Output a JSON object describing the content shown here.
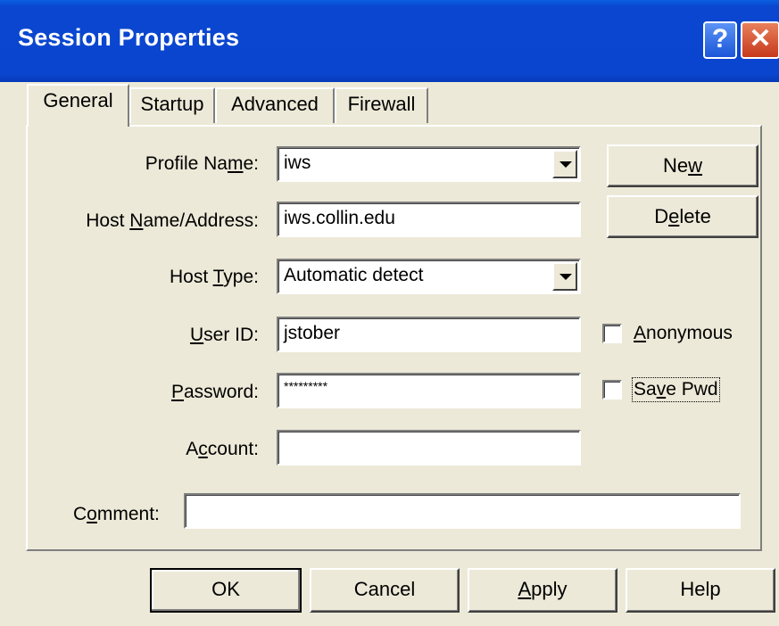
{
  "window": {
    "title": "Session Properties",
    "help_glyph": "?",
    "close_glyph": "✕"
  },
  "tabs": [
    {
      "label": "General"
    },
    {
      "label": "Startup"
    },
    {
      "label": "Advanced"
    },
    {
      "label": "Firewall"
    }
  ],
  "form": {
    "profile_name": {
      "label_pre": "Profile Na",
      "label_key": "m",
      "label_post": "e:",
      "value": "iws"
    },
    "host_name": {
      "label_pre": "Host ",
      "label_key": "N",
      "label_post": "ame/Address:",
      "value": "iws.collin.edu"
    },
    "host_type": {
      "label_pre": "Host ",
      "label_key": "T",
      "label_post": "ype:",
      "value": "Automatic detect"
    },
    "user_id": {
      "label_pre": "",
      "label_key": "U",
      "label_post": "ser ID:",
      "value": "jstober"
    },
    "password": {
      "label_pre": "",
      "label_key": "P",
      "label_post": "assword:",
      "value": "*********"
    },
    "account": {
      "label_pre": "A",
      "label_key": "c",
      "label_post": "count:",
      "value": ""
    },
    "comment": {
      "label_pre": "C",
      "label_key": "o",
      "label_post": "mment:",
      "value": ""
    }
  },
  "side_buttons": {
    "new": {
      "pre": "Ne",
      "key": "w",
      "post": ""
    },
    "delete": {
      "pre": "D",
      "key": "e",
      "post": "lete"
    }
  },
  "checkboxes": {
    "anonymous": {
      "pre": "",
      "key": "A",
      "post": "nonymous",
      "checked": false
    },
    "save_pwd": {
      "pre": "Sa",
      "key": "v",
      "post": "e Pwd",
      "checked": false
    }
  },
  "footer": {
    "ok": "OK",
    "cancel": "Cancel",
    "apply": {
      "pre": "",
      "key": "A",
      "post": "pply"
    },
    "help": "Help"
  }
}
